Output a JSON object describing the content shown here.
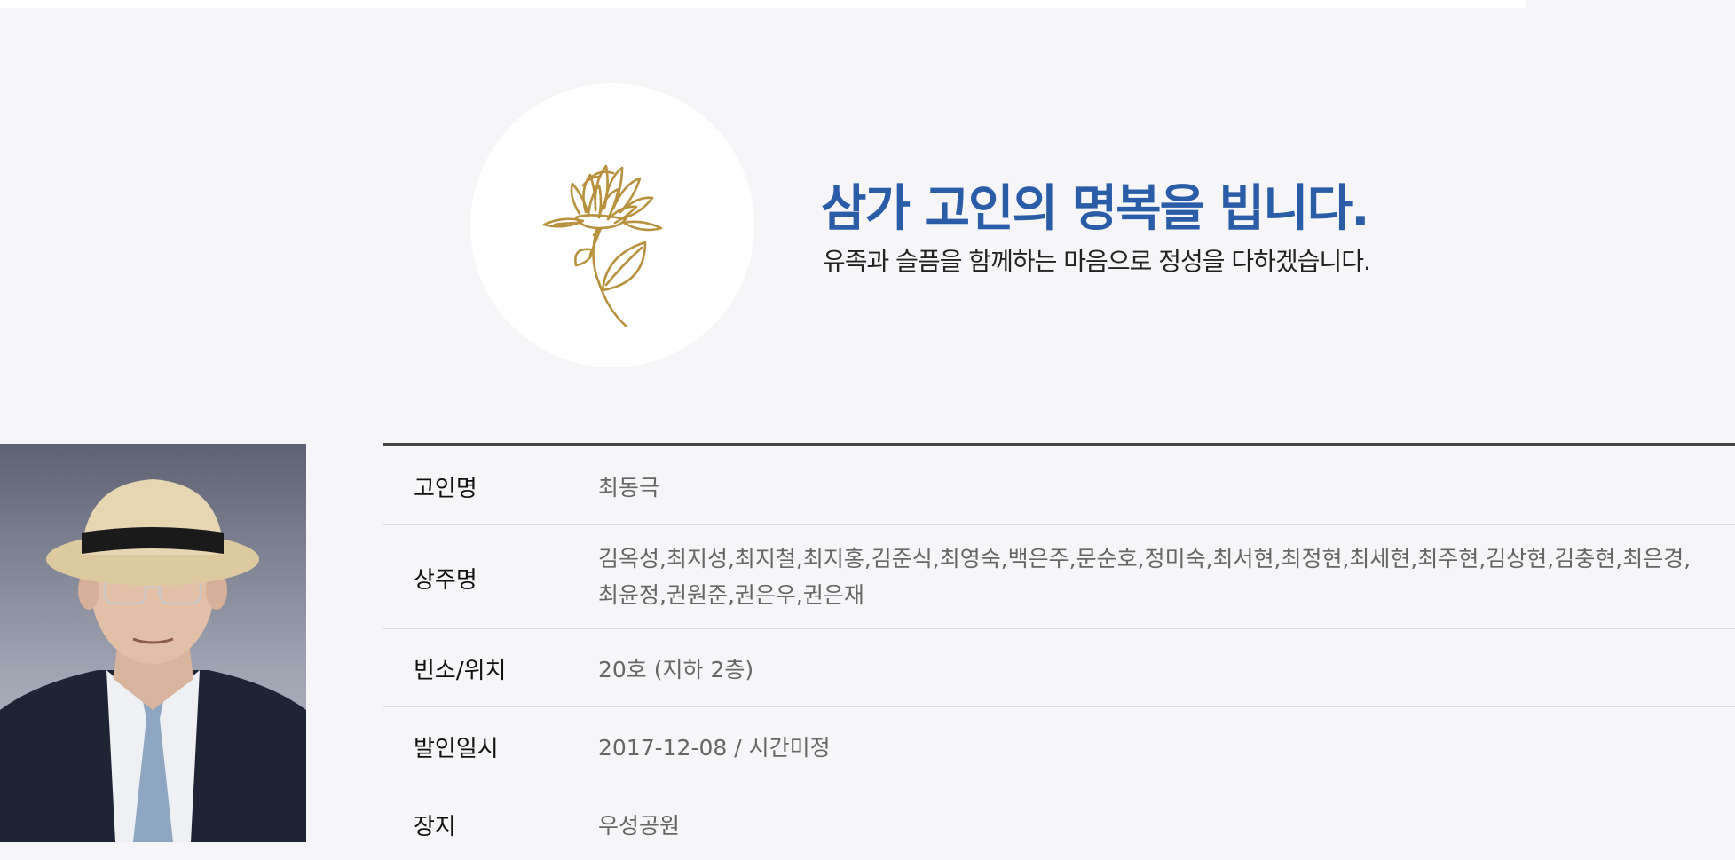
{
  "header": {
    "headline": "삼가 고인의 명복을 빕니다.",
    "subline": "유족과 슬픔을 함께하는 마음으로 정성을 다하겠습니다."
  },
  "icons": {
    "flower": "chrysanthemum-icon"
  },
  "colors": {
    "headline": "#2a5ca8",
    "flower_gold": "#b8913f",
    "page_background": "#f6f6f8"
  },
  "info": {
    "rows": [
      {
        "label": "고인명",
        "value": "최동극"
      },
      {
        "label": "상주명",
        "value": "김옥성,최지성,최지철,최지홍,김준식,최영숙,백은주,문순호,정미숙,최서현,최정현,최세현,최주현,김상현,김충현,최은경,최윤정,권원준,권은우,권은재"
      },
      {
        "label": "빈소/위치",
        "value": "20호 (지하 2층)"
      },
      {
        "label": "발인일시",
        "value": "2017-12-08 / 시간미정"
      },
      {
        "label": "장지",
        "value": "우성공원"
      }
    ]
  }
}
